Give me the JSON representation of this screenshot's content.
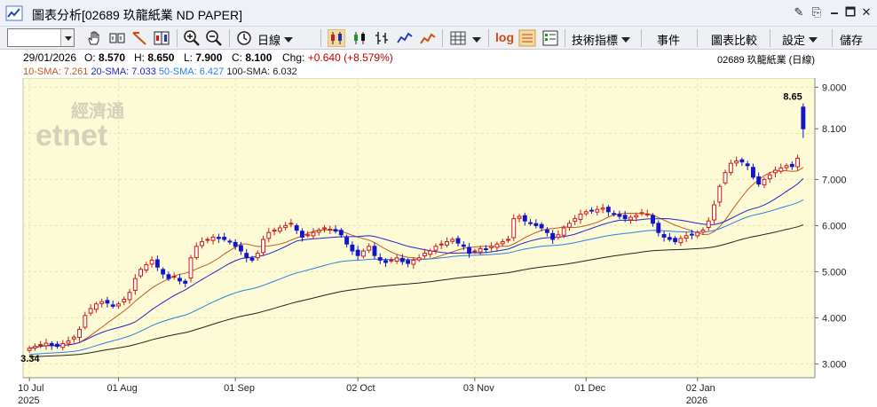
{
  "window": {
    "title": "圖表分析[02689 玖龍紙業 ND PAPER]",
    "controls": [
      "✎",
      "⎘",
      "🗕",
      "🗖",
      "✕"
    ]
  },
  "toolbar": {
    "symbol_value": "",
    "period_label": "日線",
    "log_label": "log",
    "indicators_label": "技術指標",
    "events_label": "事件",
    "compare_label": "圖表比較",
    "settings_label": "設定",
    "save_label": "儲存"
  },
  "quote": {
    "date": "29/01/2026",
    "open_label": "O:",
    "open": "8.570",
    "high_label": "H:",
    "high": "8.650",
    "low_label": "L:",
    "low": "7.900",
    "close_label": "C:",
    "close": "8.100",
    "chg_label": "Chg:",
    "chg": "+0.640 (+8.579%)",
    "stock_label": "02689  玖龍紙業 (日線)"
  },
  "indicators": {
    "sma10": "10-SMA: 7.261",
    "sma20": "20-SMA: 7.033",
    "sma50": "50-SMA: 6.427",
    "sma100": "100-SMA: 6.032"
  },
  "colors": {
    "plot_bg": "#fcfbd5",
    "up": "#d01818",
    "down": "#1414c8",
    "sma10": "#c05a20",
    "sma20": "#2424c8",
    "sma50": "#2a7fe6",
    "sma100": "#222222",
    "chg": "#c00000"
  },
  "watermark": {
    "line1": "經濟通",
    "line2": "etnet"
  },
  "chart_data": {
    "type": "candlestick",
    "ylim": [
      2.7,
      9.2
    ],
    "yticks": [
      3.0,
      4.0,
      5.0,
      6.0,
      7.0,
      8.0,
      9.0
    ],
    "ytick_labels": [
      "3.000",
      "4.000",
      "5.000",
      "6.000",
      "7.000",
      "8.100",
      "9.000"
    ],
    "last_close": 8.1,
    "x_labels": [
      {
        "label": "10 Jul",
        "year": "2025",
        "index": 0
      },
      {
        "label": "01 Aug",
        "year": "",
        "index": 16
      },
      {
        "label": "01 Sep",
        "year": "",
        "index": 37
      },
      {
        "label": "02 Oct",
        "year": "",
        "index": 59
      },
      {
        "label": "03 Nov",
        "year": "",
        "index": 80
      },
      {
        "label": "01 Dec",
        "year": "",
        "index": 100
      },
      {
        "label": "02 Jan",
        "year": "2026",
        "index": 120
      }
    ],
    "annotations": [
      {
        "text": "8.65",
        "index": 137,
        "value": 8.65,
        "pos": "above"
      },
      {
        "text": "3.34",
        "index": 0,
        "value": 3.3,
        "pos": "below"
      }
    ],
    "closes": [
      3.34,
      3.38,
      3.42,
      3.45,
      3.4,
      3.38,
      3.44,
      3.5,
      3.58,
      3.75,
      4.05,
      4.2,
      4.3,
      4.35,
      4.32,
      4.25,
      4.3,
      4.4,
      4.55,
      4.85,
      5.05,
      5.15,
      5.25,
      5.1,
      4.95,
      4.85,
      4.9,
      4.8,
      4.75,
      5.3,
      5.55,
      5.65,
      5.7,
      5.75,
      5.72,
      5.7,
      5.65,
      5.55,
      5.45,
      5.3,
      5.25,
      5.4,
      5.7,
      5.85,
      5.9,
      5.95,
      6.0,
      6.05,
      5.9,
      5.75,
      5.8,
      5.85,
      5.9,
      5.95,
      5.92,
      5.88,
      5.8,
      5.6,
      5.45,
      5.35,
      5.45,
      5.55,
      5.35,
      5.25,
      5.2,
      5.25,
      5.3,
      5.22,
      5.18,
      5.25,
      5.3,
      5.4,
      5.45,
      5.55,
      5.6,
      5.65,
      5.7,
      5.62,
      5.55,
      5.4,
      5.45,
      5.5,
      5.48,
      5.55,
      5.6,
      5.65,
      5.7,
      6.15,
      6.2,
      6.1,
      6.05,
      6.0,
      5.95,
      5.85,
      5.7,
      5.8,
      5.95,
      6.05,
      6.15,
      6.25,
      6.3,
      6.32,
      6.35,
      6.38,
      6.3,
      6.25,
      6.2,
      6.15,
      6.18,
      6.22,
      6.28,
      6.25,
      6.05,
      5.85,
      5.75,
      5.7,
      5.65,
      5.72,
      5.78,
      5.8,
      5.85,
      5.9,
      6.1,
      6.45,
      6.85,
      7.15,
      7.35,
      7.4,
      7.38,
      7.3,
      7.05,
      6.9,
      7.0,
      7.1,
      7.2,
      7.25,
      7.3,
      7.28,
      7.46,
      8.1
    ]
  }
}
